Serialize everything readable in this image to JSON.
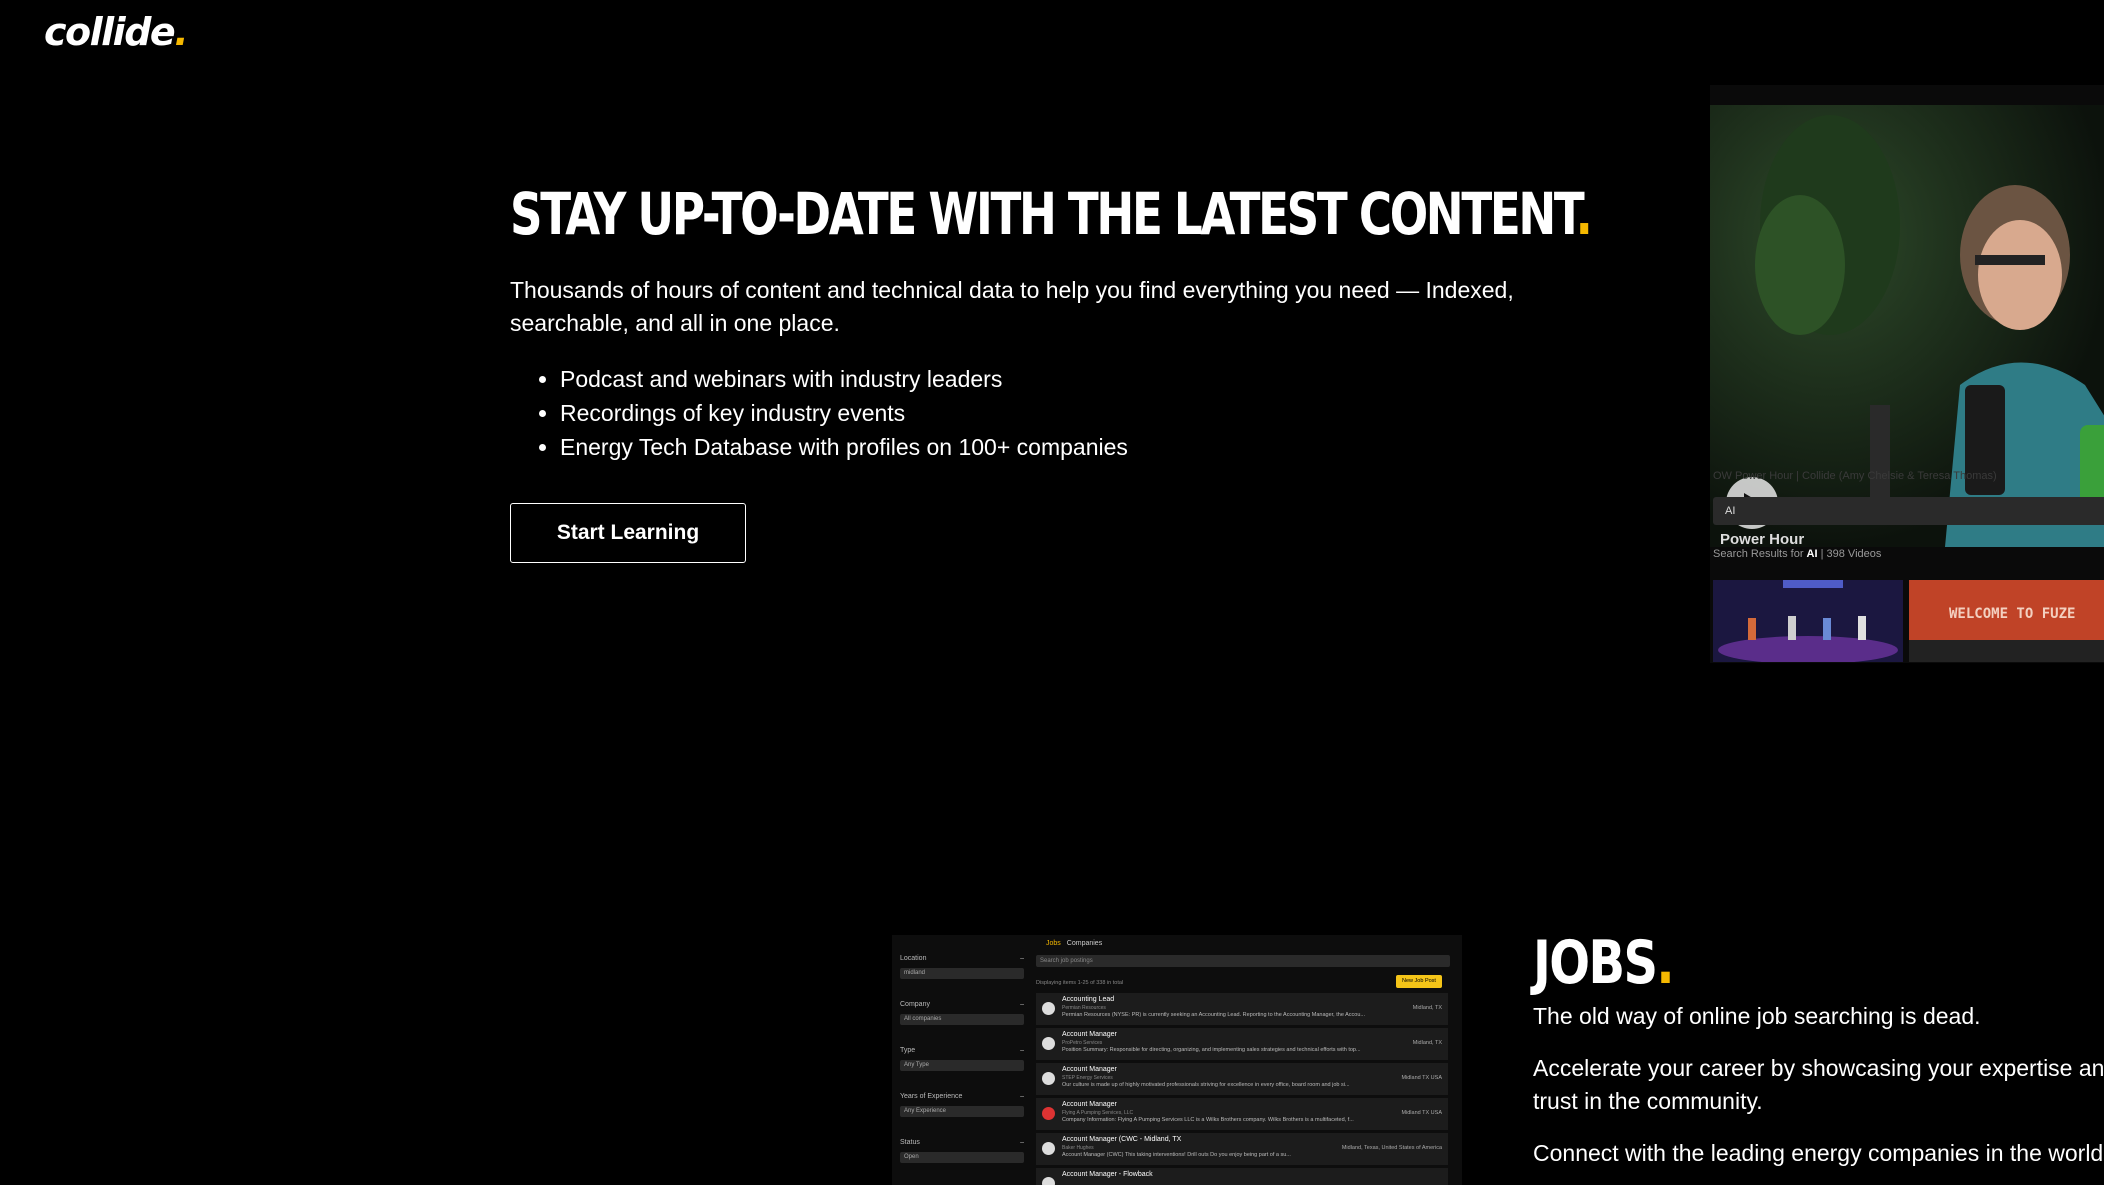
{
  "logo": {
    "text": "collide",
    "dot": "."
  },
  "hero": {
    "title": "STAY UP-TO-DATE WITH THE LATEST CONTENT",
    "title_dot": ".",
    "description": "Thousands of hours of content and technical data to help you find everything you need —  Indexed, searchable, and all in one place.",
    "bullets": [
      "Podcast and webinars with industry leaders",
      "Recordings of key industry events",
      "Energy Tech Database with profiles on 100+ companies"
    ],
    "cta_label": "Start Learning"
  },
  "video_panel": {
    "show_label": "Power Hour",
    "video_title": "OW Power Hour | Collide (Amy Chelsie & Teresa Thomas)",
    "search_value": "AI",
    "results_prefix": "Search Results for",
    "results_query": "AI",
    "results_count": "| 398 Videos",
    "thumb2_text": "WELCOME TO FUZE"
  },
  "jobs_mock": {
    "tabs": [
      "Jobs",
      "Companies"
    ],
    "filters": [
      {
        "label": "Location",
        "value": "midland"
      },
      {
        "label": "Company",
        "value": "All companies"
      },
      {
        "label": "Type",
        "value": "Any Type"
      },
      {
        "label": "Years of Experience",
        "value": "Any Experience"
      },
      {
        "label": "Status",
        "value": "Open"
      }
    ],
    "search_placeholder": "Search job postings",
    "count_text": "Displaying items 1-25 of 338 in total",
    "new_job_label": "New Job Post",
    "rows": [
      {
        "title": "Accounting Lead",
        "company": "Permian Resources",
        "desc": "Permian Resources (NYSE: PR) is currently seeking an Accounting Lead. Reporting to the Accounting Manager, the Accou...",
        "loc": "Midland, TX"
      },
      {
        "title": "Account Manager",
        "company": "ProPetro Services",
        "desc": "Position Summary: Responsible for directing, organizing, and implementing sales strategies and technical efforts with top...",
        "loc": "Midland, TX"
      },
      {
        "title": "Account Manager",
        "company": "STEP Energy Services",
        "desc": "Our culture is made up of highly motivated professionals striving for excellence in every office, board room and job si...",
        "loc": "Midland TX USA"
      },
      {
        "title": "Account Manager",
        "company": "Flying A Pumping Services, LLC",
        "desc": "Company Information: Flying A Pumping Services LLC is a Wilks Brothers company. Wilks Brothers is a multifaceted, f...",
        "loc": "Midland TX USA"
      },
      {
        "title": "Account Manager (CWC - Midland, TX",
        "company": "Baker Hughes",
        "desc": "Account Manager (CWC) This taking interventions! Drill outs Do you enjoy being part of a su...",
        "loc": "Midland, Texas, United States of America"
      },
      {
        "title": "Account Manager - Flowback",
        "company": "",
        "desc": "",
        "loc": ""
      }
    ]
  },
  "jobs": {
    "title": "JOBS",
    "title_dot": ".",
    "p1": "The old way of online job searching is dead.",
    "p2": "Accelerate your career by showcasing your expertise and trust in the community.",
    "p3": "Connect with the leading energy companies in the world a"
  }
}
